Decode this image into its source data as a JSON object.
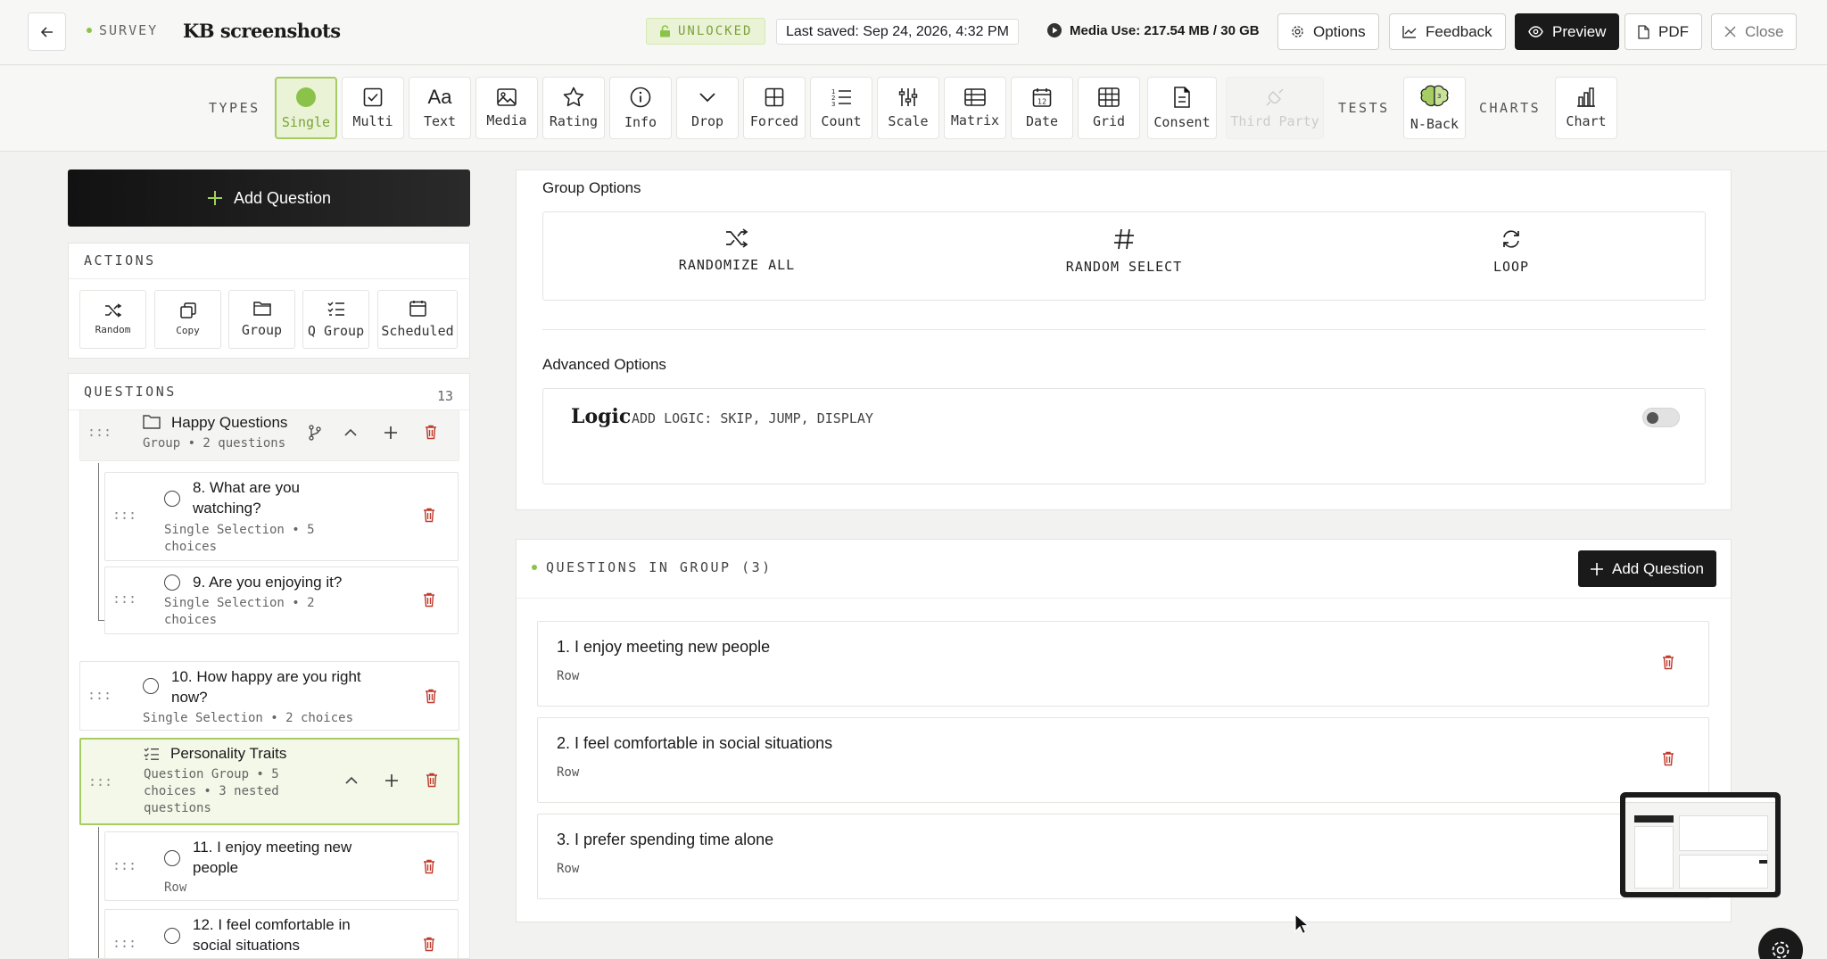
{
  "header": {
    "survey_tag": "SURVEY",
    "title": "KB screenshots",
    "lock_status": "UNLOCKED",
    "last_saved": "Last saved: Sep 24, 2026, 4:32 PM",
    "media_use": "Media Use: 217.54 MB / 30 GB",
    "buttons": {
      "options": "Options",
      "feedback": "Feedback",
      "preview": "Preview",
      "pdf": "PDF",
      "close": "Close"
    }
  },
  "toolbar": {
    "types_label": "TYPES",
    "tests_label": "TESTS",
    "charts_label": "CHARTS",
    "types": [
      {
        "label": "Single",
        "icon": "single-choice-icon",
        "active": true
      },
      {
        "label": "Multi",
        "icon": "checkbox-icon"
      },
      {
        "label": "Text",
        "icon": "text-icon"
      },
      {
        "label": "Media",
        "icon": "image-icon"
      },
      {
        "label": "Rating",
        "icon": "star-icon"
      },
      {
        "label": "Info",
        "icon": "info-icon"
      },
      {
        "label": "Drop",
        "icon": "chevron-down-icon"
      },
      {
        "label": "Forced",
        "icon": "grid-icon"
      },
      {
        "label": "Count",
        "icon": "numbered-list-icon"
      },
      {
        "label": "Scale",
        "icon": "sliders-icon"
      },
      {
        "label": "Matrix",
        "icon": "matrix-icon"
      },
      {
        "label": "Date",
        "icon": "calendar-icon"
      },
      {
        "label": "Grid",
        "icon": "table-icon"
      },
      {
        "label": "Consent",
        "icon": "document-icon"
      },
      {
        "label": "Third Party",
        "icon": "plugin-icon",
        "disabled": true
      }
    ],
    "tests": [
      {
        "label": "N-Back",
        "icon": "brain-icon"
      }
    ],
    "charts": [
      {
        "label": "Chart",
        "icon": "bar-chart-icon"
      }
    ]
  },
  "sidebar": {
    "add_question": "Add Question",
    "actions_label": "ACTIONS",
    "actions": [
      {
        "label": "Random",
        "icon": "shuffle-icon"
      },
      {
        "label": "Copy",
        "icon": "copy-icon"
      },
      {
        "label": "Group",
        "icon": "folder-icon"
      },
      {
        "label": "Q Group",
        "icon": "checklist-icon"
      },
      {
        "label": "Scheduled",
        "icon": "calendar-icon"
      }
    ],
    "questions_label": "QUESTIONS",
    "questions_count": "13",
    "items": [
      {
        "title": "Happy Questions",
        "subtitle": "Group • 2 questions"
      },
      {
        "title": "8. What are you watching?",
        "subtitle": "Single Selection • 5 choices"
      },
      {
        "title": "9. Are you enjoying it?",
        "subtitle": "Single Selection • 2 choices"
      },
      {
        "title": "10. How happy are you right now?",
        "subtitle": "Single Selection • 2 choices"
      },
      {
        "title": "Personality Traits",
        "subtitle": "Question Group • 5 choices • 3 nested questions"
      },
      {
        "title": "11. I enjoy meeting new people",
        "subtitle": "Row"
      },
      {
        "title": "12. I feel comfortable in social situations",
        "subtitle": ""
      }
    ]
  },
  "main": {
    "group_options_title": "Group Options",
    "group_options": [
      {
        "label": "RANDOMIZE ALL",
        "icon": "shuffle-icon"
      },
      {
        "label": "RANDOM SELECT",
        "icon": "hash-icon"
      },
      {
        "label": "LOOP",
        "icon": "loop-icon"
      }
    ],
    "advanced_title": "Advanced Options",
    "logic_title": "Logic",
    "logic_desc": "ADD LOGIC: SKIP, JUMP, DISPLAY",
    "logic_enabled": false,
    "group_questions_label": "QUESTIONS IN GROUP (3)",
    "add_question": "Add Question",
    "group_questions": [
      {
        "title": "1. I enjoy meeting new people",
        "subtitle": "Row"
      },
      {
        "title": "2. I feel comfortable in social situations",
        "subtitle": "Row"
      },
      {
        "title": "3. I prefer spending time alone",
        "subtitle": "Row"
      }
    ]
  },
  "colors": {
    "accent_green": "#8bc34a",
    "danger_red": "#c0392b",
    "dark": "#1a1a1a"
  }
}
